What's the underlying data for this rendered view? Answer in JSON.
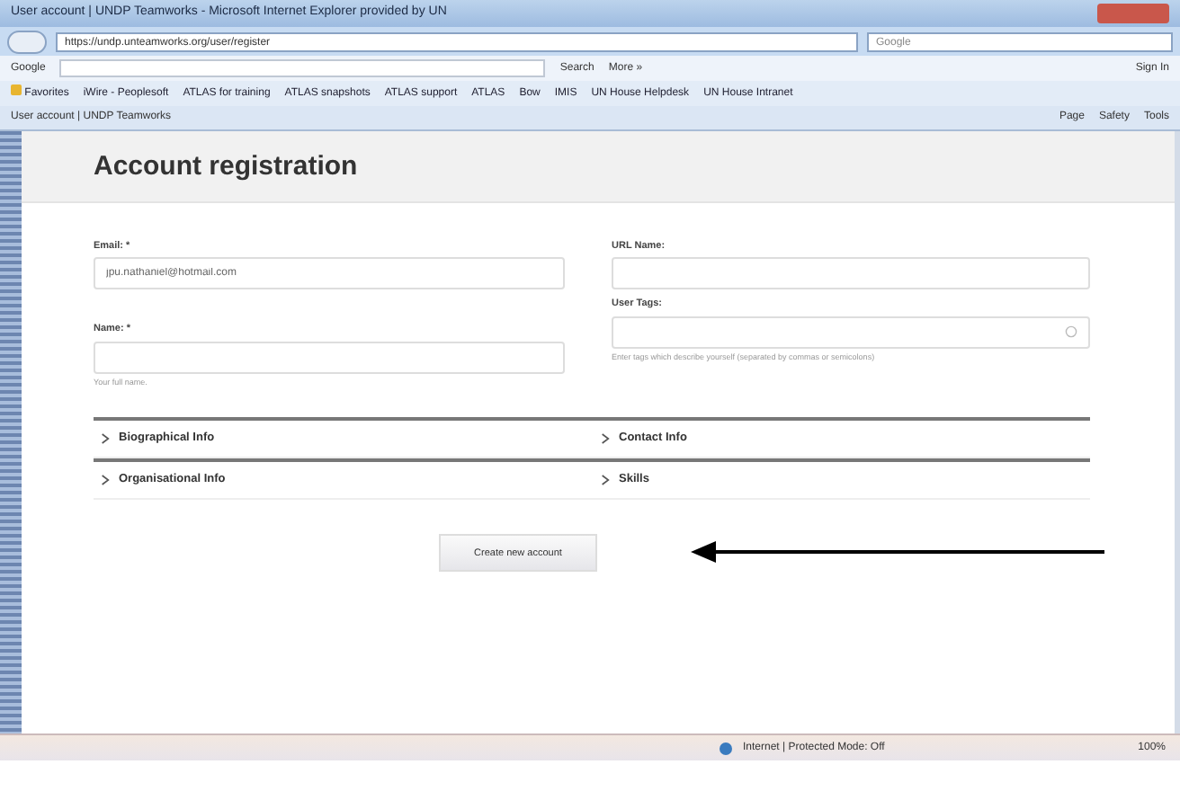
{
  "window": {
    "title": "User account | UNDP Teamworks - Microsoft Internet Explorer provided by UN"
  },
  "address_bar": {
    "url": "https://undp.unteamworks.org/user/register",
    "search_placeholder": "Google"
  },
  "google_toolbar": {
    "label": "Google",
    "search": "Search",
    "more": "More »",
    "sign_in": "Sign In"
  },
  "favorites": {
    "label": "Favorites",
    "links": [
      "iWire - Peoplesoft",
      "ATLAS for training",
      "ATLAS snapshots",
      "ATLAS support",
      "ATLAS",
      "Bow",
      "IMIS",
      "UN House Helpdesk",
      "UN House Intranet"
    ]
  },
  "tab": {
    "title": "User account | UNDP Teamworks"
  },
  "command_bar": [
    "Page",
    "Safety",
    "Tools"
  ],
  "page": {
    "heading": "Account registration",
    "left_fields": [
      {
        "label": "Email: *",
        "value": "jpu.nathaniel@hotmail.com",
        "kind": "text"
      },
      {
        "label": "Name: *",
        "help": "Your full name.",
        "kind": "text"
      }
    ],
    "right_fields": [
      {
        "label": "URL Name:",
        "kind": "text"
      },
      {
        "label": "User Tags:",
        "help": "Enter tags which describe yourself (separated by commas or semicolons)",
        "kind": "tags"
      }
    ],
    "sections": [
      {
        "label": "Biographical Info",
        "expanded": false
      },
      {
        "label": "Contact Info",
        "expanded": false
      },
      {
        "label": "Organisational Info",
        "expanded": false
      },
      {
        "label": "Skills",
        "expanded": false
      }
    ],
    "submit": "Create new account"
  },
  "status_bar": {
    "zone": "Internet | Protected Mode: Off",
    "zoom": "100%"
  }
}
